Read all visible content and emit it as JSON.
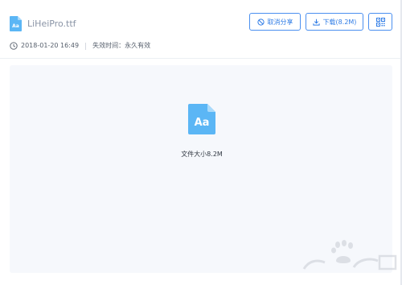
{
  "file": {
    "name": "LiHeiPro.ttf",
    "icon_glyph": "Aa",
    "date": "2018-01-20 16:49",
    "expiry": "失效时间：永久有效",
    "size_text": "文件大小8.2M"
  },
  "actions": {
    "cancel_share": "取消分享",
    "download": "下载(8.2M)"
  },
  "icons": {
    "file": "font-file-icon",
    "clock": "clock-icon",
    "cancel": "ban-icon",
    "download": "download-icon",
    "qr": "qr-code-icon"
  },
  "colors": {
    "accent": "#2f7ce6",
    "file_icon": "#5bb6f5"
  }
}
